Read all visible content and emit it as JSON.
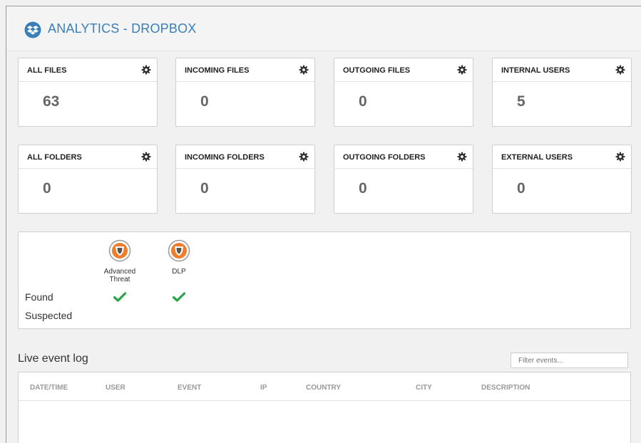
{
  "header": {
    "title": "ANALYTICS - DROPBOX",
    "logo_icon": "dropbox-icon"
  },
  "cards": [
    {
      "label": "ALL FILES",
      "value": "63"
    },
    {
      "label": "INCOMING FILES",
      "value": "0"
    },
    {
      "label": "OUTGOING FILES",
      "value": "0"
    },
    {
      "label": "INTERNAL USERS",
      "value": "5"
    },
    {
      "label": "ALL FOLDERS",
      "value": "0"
    },
    {
      "label": "INCOMING FOLDERS",
      "value": "0"
    },
    {
      "label": "OUTGOING FOLDERS",
      "value": "0"
    },
    {
      "label": "EXTERNAL USERS",
      "value": "0"
    }
  ],
  "security": {
    "columns": [
      {
        "label_line1": "Advanced",
        "label_line2": "Threat",
        "icon": "shield-icon",
        "found": true
      },
      {
        "label_line1": "DLP",
        "label_line2": "",
        "icon": "shield-icon",
        "found": true
      }
    ],
    "rows": {
      "found": "Found",
      "suspected": "Suspected"
    }
  },
  "log": {
    "title": "Live event log",
    "filter_placeholder": "Filter events...",
    "columns": [
      "DATE/TIME",
      "USER",
      "EVENT",
      "IP",
      "COUNTRY",
      "CITY",
      "DESCRIPTION"
    ],
    "rows": []
  },
  "colors": {
    "accent": "#3a7fb8",
    "check": "#2aa44a",
    "shield_orange": "#f07d2a"
  }
}
